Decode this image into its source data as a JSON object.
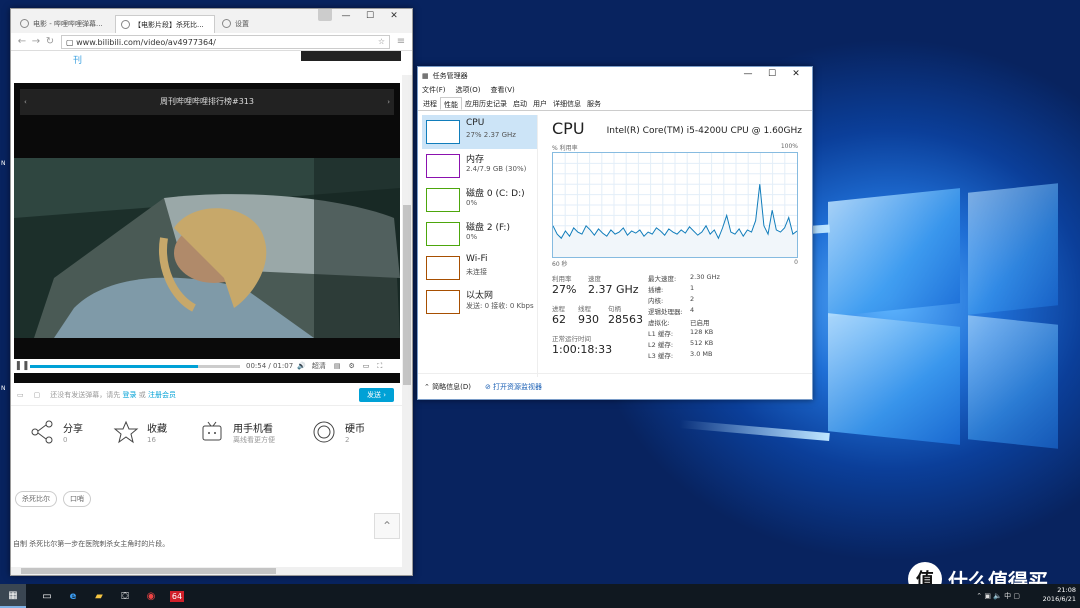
{
  "browser": {
    "tabs": [
      "电影 - 哔哩哔哩弹幕...",
      "【电影片段】杀死比...",
      "设置"
    ],
    "url": "www.bilibili.com/video/av4977364/",
    "strip_link": "刊",
    "player_title": "周刊哔哩哔哩排行榜#313",
    "time": "00:54 / 01:07",
    "quality": "超清",
    "danmu_placeholder_pre": "还没有发送弹幕，请先",
    "login": "登录",
    "or": "或",
    "register": "注册会员",
    "send": "发送",
    "actions": [
      {
        "label": "分享",
        "count": "0"
      },
      {
        "label": "收藏",
        "count": "16"
      },
      {
        "label": "用手机看",
        "count": "离线看更方便"
      },
      {
        "label": "硬币",
        "count": "2"
      }
    ],
    "tags": [
      "杀死比尔",
      "口哨"
    ],
    "description": "自制 杀死比尔第一步在医院刺杀女主角时的片段。",
    "progress": 0.8
  },
  "taskmanager": {
    "title": "任务管理器",
    "menu": [
      "文件(F)",
      "选项(O)",
      "查看(V)"
    ],
    "tabs": [
      "进程",
      "性能",
      "应用历史记录",
      "启动",
      "用户",
      "详细信息",
      "服务"
    ],
    "resources": [
      {
        "name": "CPU",
        "value": "27%  2.37 GHz",
        "color": "#117dbb"
      },
      {
        "name": "内存",
        "value": "2.4/7.9 GB (30%)",
        "color": "#8b12ae"
      },
      {
        "name": "磁盘 0 (C: D:)",
        "value": "0%",
        "color": "#4da60c"
      },
      {
        "name": "磁盘 2 (F:)",
        "value": "0%",
        "color": "#4da60c"
      },
      {
        "name": "Wi-Fi",
        "value": "未连接",
        "color": "#a74f01"
      },
      {
        "name": "以太网",
        "value": "发送: 0  接收: 0 Kbps",
        "color": "#a74f01"
      }
    ],
    "cpu_title": "CPU",
    "cpu_model": "Intel(R) Core(TM) i5-4200U CPU @ 1.60GHz",
    "graph_label_left": "% 利用率",
    "graph_label_right": "100%",
    "graph_bottom_left": "60 秒",
    "graph_bottom_right": "0",
    "stats": {
      "util_label": "利用率",
      "util": "27%",
      "speed_label": "速度",
      "speed": "2.37 GHz",
      "proc_label": "进程",
      "proc": "62",
      "threads_label": "线程",
      "threads": "930",
      "handles_label": "句柄",
      "handles": "28563",
      "uptime_label": "正常运行时间",
      "uptime": "1:00:18:33"
    },
    "specs": [
      [
        "最大速度:",
        "2.30 GHz"
      ],
      [
        "插槽:",
        "1"
      ],
      [
        "内核:",
        "2"
      ],
      [
        "逻辑处理器:",
        "4"
      ],
      [
        "虚拟化:",
        "已启用"
      ],
      [
        "L1 缓存:",
        "128 KB"
      ],
      [
        "L2 缓存:",
        "512 KB"
      ],
      [
        "L3 缓存:",
        "3.0 MB"
      ]
    ],
    "footer_brief": "简略信息(D)",
    "footer_monitor": "打开资源监视器",
    "cpu_history": [
      30,
      22,
      18,
      25,
      20,
      28,
      24,
      22,
      30,
      26,
      21,
      27,
      23,
      20,
      26,
      22,
      24,
      28,
      21,
      25,
      23,
      26,
      20,
      24,
      22,
      28,
      25,
      21,
      27,
      24,
      22,
      26,
      23,
      29,
      25,
      21,
      24,
      30,
      22,
      26,
      18,
      28,
      40,
      24,
      22,
      27,
      20,
      26,
      24,
      35,
      70,
      30,
      22,
      45,
      26,
      24,
      28,
      38,
      22,
      25
    ]
  },
  "taskbar": {
    "clock_time": "21:08",
    "clock_date": "2016/6/21",
    "ime": "中",
    "app_badge": "64"
  },
  "watermark": {
    "text": "什么值得买",
    "badge": "值"
  },
  "edge_texts": [
    "N",
    "N",
    "N"
  ]
}
